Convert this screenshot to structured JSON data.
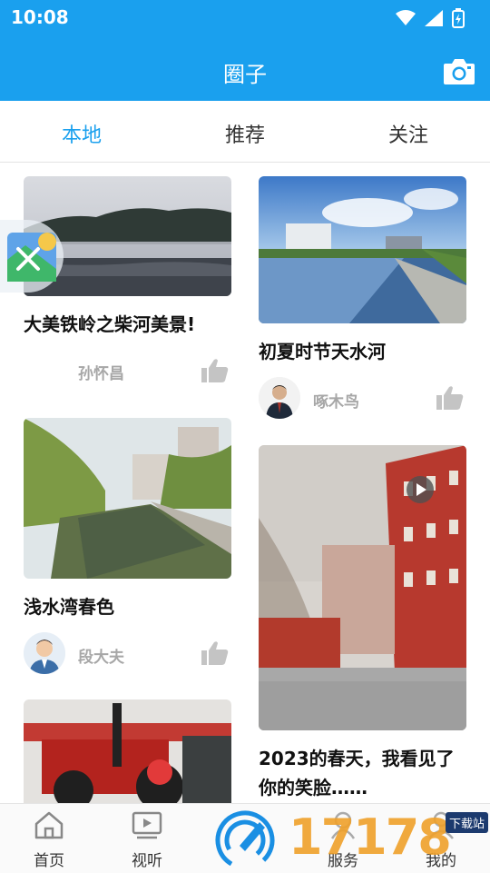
{
  "status_bar": {
    "time": "10:08"
  },
  "header": {
    "title": "圈子"
  },
  "tabs": [
    {
      "label": "本地",
      "active": true
    },
    {
      "label": "推荐",
      "active": false
    },
    {
      "label": "关注",
      "active": false
    }
  ],
  "feed": {
    "left": [
      {
        "title": "大美铁岭之柴河美景!",
        "author": "孙怀昌"
      },
      {
        "title": "浅水湾春色",
        "author": "段大夫"
      }
    ],
    "right": [
      {
        "title": "初夏时节天水河",
        "author": "啄木鸟"
      },
      {
        "title_line1": "2023的春天，我看见了",
        "title_line2": "你的笑脸……"
      }
    ]
  },
  "bottom_nav": [
    {
      "label": "首页",
      "icon": "home-icon"
    },
    {
      "label": "视听",
      "icon": "video-icon"
    },
    {
      "label": "",
      "icon": "center-action-icon"
    },
    {
      "label": "服务",
      "icon": "service-icon"
    },
    {
      "label": "我的",
      "icon": "profile-icon"
    }
  ],
  "watermark": {
    "digits": "17178",
    "tag": "下载站"
  },
  "colors": {
    "accent": "#1aa0ee",
    "title_text": "#111111",
    "author_text": "#a7a7a7"
  }
}
